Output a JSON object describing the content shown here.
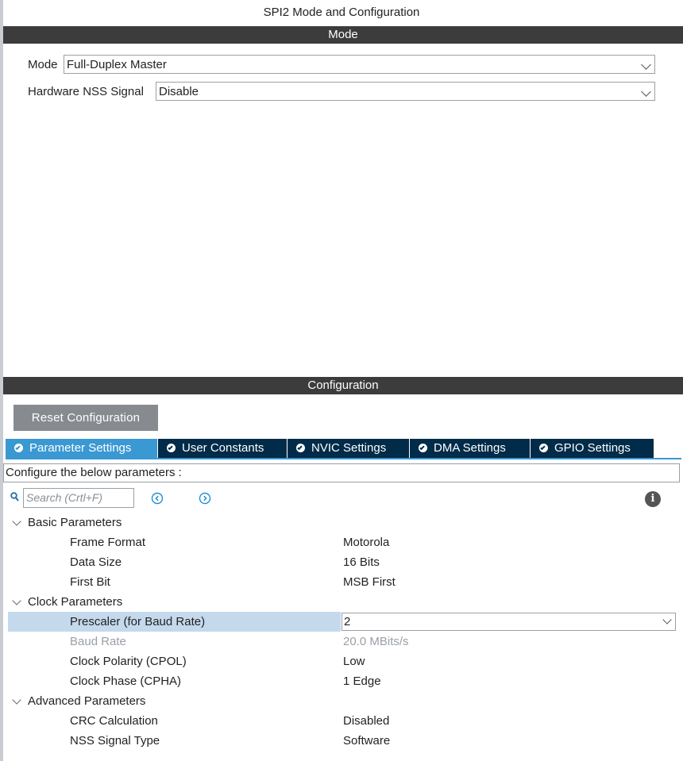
{
  "window_title": "SPI2 Mode and Configuration",
  "mode_section": {
    "header": "Mode",
    "fields": [
      {
        "label": "Mode",
        "value": "Full-Duplex Master"
      },
      {
        "label": "Hardware NSS Signal",
        "value": "Disable"
      }
    ]
  },
  "configuration_section": {
    "header": "Configuration",
    "reset_button": "Reset Configuration",
    "tabs": [
      {
        "label": "Parameter Settings",
        "active": true
      },
      {
        "label": "User Constants",
        "active": false
      },
      {
        "label": "NVIC Settings",
        "active": false
      },
      {
        "label": "DMA Settings",
        "active": false
      },
      {
        "label": "GPIO Settings",
        "active": false
      }
    ],
    "description": "Configure the below parameters :",
    "search_placeholder": "Search (Crtl+F)",
    "groups": [
      {
        "name": "Basic Parameters",
        "params": [
          {
            "name": "Frame Format",
            "value": "Motorola"
          },
          {
            "name": "Data Size",
            "value": "16 Bits"
          },
          {
            "name": "First Bit",
            "value": "MSB First"
          }
        ]
      },
      {
        "name": "Clock Parameters",
        "params": [
          {
            "name": "Prescaler (for Baud Rate)",
            "value": "2",
            "selected": true
          },
          {
            "name": "Baud Rate",
            "value": "20.0 MBits/s",
            "disabled": true
          },
          {
            "name": "Clock Polarity (CPOL)",
            "value": "Low"
          },
          {
            "name": "Clock Phase (CPHA)",
            "value": "1 Edge"
          }
        ]
      },
      {
        "name": "Advanced Parameters",
        "params": [
          {
            "name": "CRC Calculation",
            "value": "Disabled"
          },
          {
            "name": "NSS Signal Type",
            "value": "Software"
          }
        ]
      }
    ]
  },
  "colors": {
    "header_bar": "#3c3c3c",
    "tab_active": "#3a98d2",
    "tab_inactive": "#002b49",
    "reset_button": "#878b90",
    "selected_row": "#c5d9ed"
  },
  "icons": [
    "search-icon",
    "previous-icon",
    "next-icon",
    "info-icon",
    "check-circle-icon",
    "chevron-down-icon",
    "expand-twisty-icon"
  ]
}
